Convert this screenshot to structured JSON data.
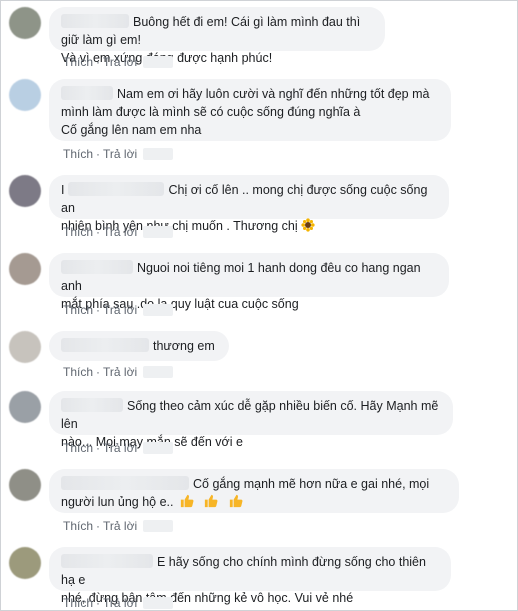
{
  "actions": {
    "like": "Thích",
    "reply": "Trả lời",
    "separator": "·"
  },
  "comments": [
    {
      "lines": [
        "Buông hết đi em! Cái gì làm mình đau thì giữ làm gì em!",
        "Và vì em xứng đáng được hạnh phúc!"
      ],
      "avatar_color": "#8e9488"
    },
    {
      "lines": [
        "Nam em ơi hãy luôn cười và nghĩ đến những tốt đẹp mà",
        "mình làm được là mình sẽ có cuộc sống đúng nghĩa à",
        "Cố gắng lên nam em nha"
      ],
      "avatar_color": "#b9cfe3"
    },
    {
      "prefix": "I",
      "lines": [
        "Chị ơi cố lên .. mong chị được sống cuộc sống an",
        "nhiên bình yên như chị muốn . Thương chị"
      ],
      "emoji": "sunflower-emoji",
      "avatar_color": "#7d7a86"
    },
    {
      "lines": [
        "Nguoi noi tiêng moi 1 hanh dong đêu co hang ngan anh",
        "mắt phía sau .do la quy luật cua cuộc sống"
      ],
      "avatar_color": "#a59a92"
    },
    {
      "lines": [
        "thương em"
      ],
      "avatar_color": "#c7c3bd"
    },
    {
      "lines": [
        "Sống theo cảm xúc dễ gặp nhiều biến cố. Hãy Mạnh mẽ lên",
        "nào... Mọi may mắn sẽ đến với e"
      ],
      "avatar_color": "#9aa0a6"
    },
    {
      "lines": [
        "Cố gắng mạnh mẽ hơn nữa e gai nhé, mọi",
        "người lun ủng hộ e.."
      ],
      "thumbs": 3,
      "avatar_color": "#8f8f87"
    },
    {
      "lines": [
        "E hãy sống cho chính mình đừng sống cho thiên hạ e",
        "nhé, đừng bận tâm đến những kẻ vô học. Vui vẻ nhé"
      ],
      "avatar_color": "#9c9a7c"
    }
  ]
}
